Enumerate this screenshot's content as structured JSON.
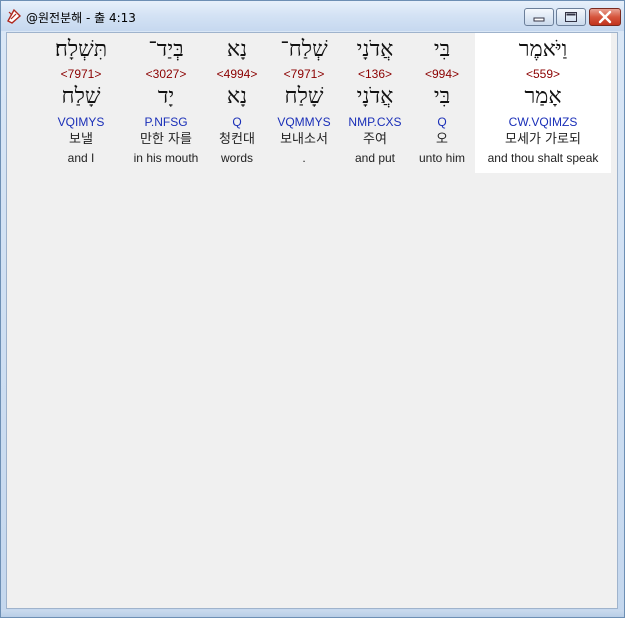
{
  "window": {
    "title": "@원전분해 - 출 4:13"
  },
  "words": [
    {
      "hebrew": "וַיֹּאמֶר",
      "strong": "<559>",
      "lemma": "אָמַר",
      "parse": "CW.VQIMZS",
      "korean": "모세가 가로되",
      "english": "and thou shalt speak",
      "selected": true
    },
    {
      "hebrew": "בִּי",
      "strong": "<994>",
      "lemma": "בִּי",
      "parse": "Q",
      "korean": "오",
      "english": "unto him",
      "selected": false
    },
    {
      "hebrew": "אֲדֹנָי",
      "strong": "<136>",
      "lemma": "אֲדֹנָי",
      "parse": "NMP.CXS",
      "korean": "주여",
      "english": "and put",
      "selected": false
    },
    {
      "hebrew": "שְׁלַח־",
      "strong": "<7971>",
      "lemma": "שָׁלַח",
      "parse": "VQMMYS",
      "korean": "보내소서",
      "english": ".",
      "selected": false
    },
    {
      "hebrew": "נָא",
      "strong": "<4994>",
      "lemma": "נָא",
      "parse": "Q",
      "korean": "청컨대",
      "english": "words",
      "selected": false
    },
    {
      "hebrew": "בְּיַד־",
      "strong": "<3027>",
      "lemma": "יָד",
      "parse": "P.NFSG",
      "korean": "만한 자를",
      "english": "in his mouth",
      "selected": false
    },
    {
      "hebrew": "תִּשְׁלָח׃",
      "strong": "<7971>",
      "lemma": "שָׁלַח",
      "parse": "VQIMYS",
      "korean": "보낼",
      "english": "and I",
      "selected": false
    }
  ]
}
